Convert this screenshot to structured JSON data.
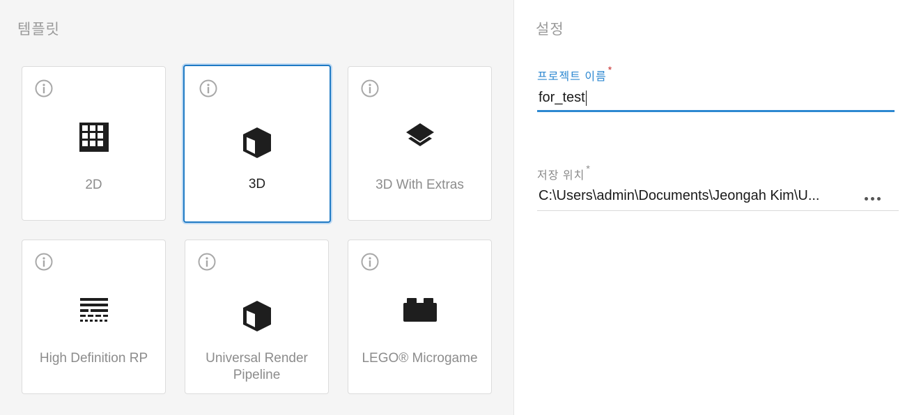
{
  "templates": {
    "title": "템플릿",
    "items": [
      {
        "label": "2D",
        "icon": "grid-icon",
        "selected": false
      },
      {
        "label": "3D",
        "icon": "cube-icon",
        "selected": true
      },
      {
        "label": "3D With Extras",
        "icon": "layers-icon",
        "selected": false
      },
      {
        "label": "High Definition RP",
        "icon": "hdrp-lines-icon",
        "selected": false
      },
      {
        "label": "Universal Render Pipeline",
        "icon": "cube-icon",
        "selected": false
      },
      {
        "label": "LEGO® Microgame",
        "icon": "lego-brick-icon",
        "selected": false
      }
    ]
  },
  "settings": {
    "title": "설정",
    "project_name": {
      "label": "프로젝트 이름",
      "required_mark": "*",
      "value": "for_test"
    },
    "location": {
      "label": "저장 위치",
      "required_mark": "*",
      "value": "C:\\Users\\admin\\Documents\\Jeongah Kim\\U..."
    }
  },
  "colors": {
    "accent": "#2d88d1",
    "selected_border": "#1f7ac4",
    "required": "#c62828",
    "left_panel_bg": "#f5f5f5"
  }
}
